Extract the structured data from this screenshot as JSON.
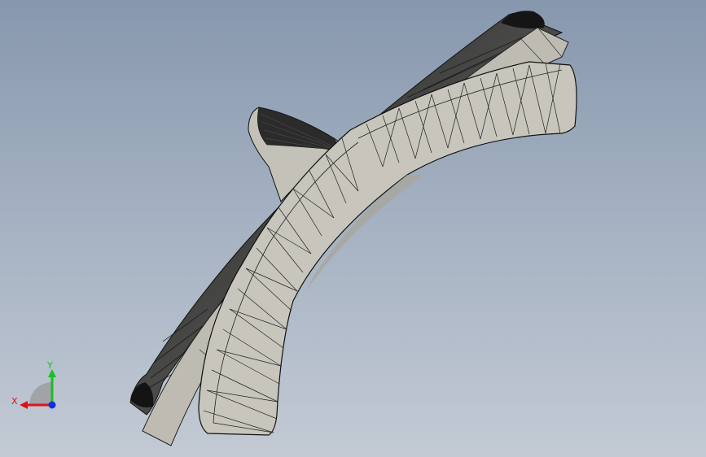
{
  "viewport": {
    "model_name": "",
    "colors": {
      "background_top": "#8797ad",
      "background_bottom": "#c3cad4",
      "face": "#c8c6bc",
      "shadow": "#2a2a2a",
      "edge": "#1a1a1a"
    }
  },
  "triad": {
    "x_label": "X",
    "y_label": "Y",
    "x_color": "#e0101a",
    "y_color": "#18c020",
    "z_color": "#1030e0"
  }
}
